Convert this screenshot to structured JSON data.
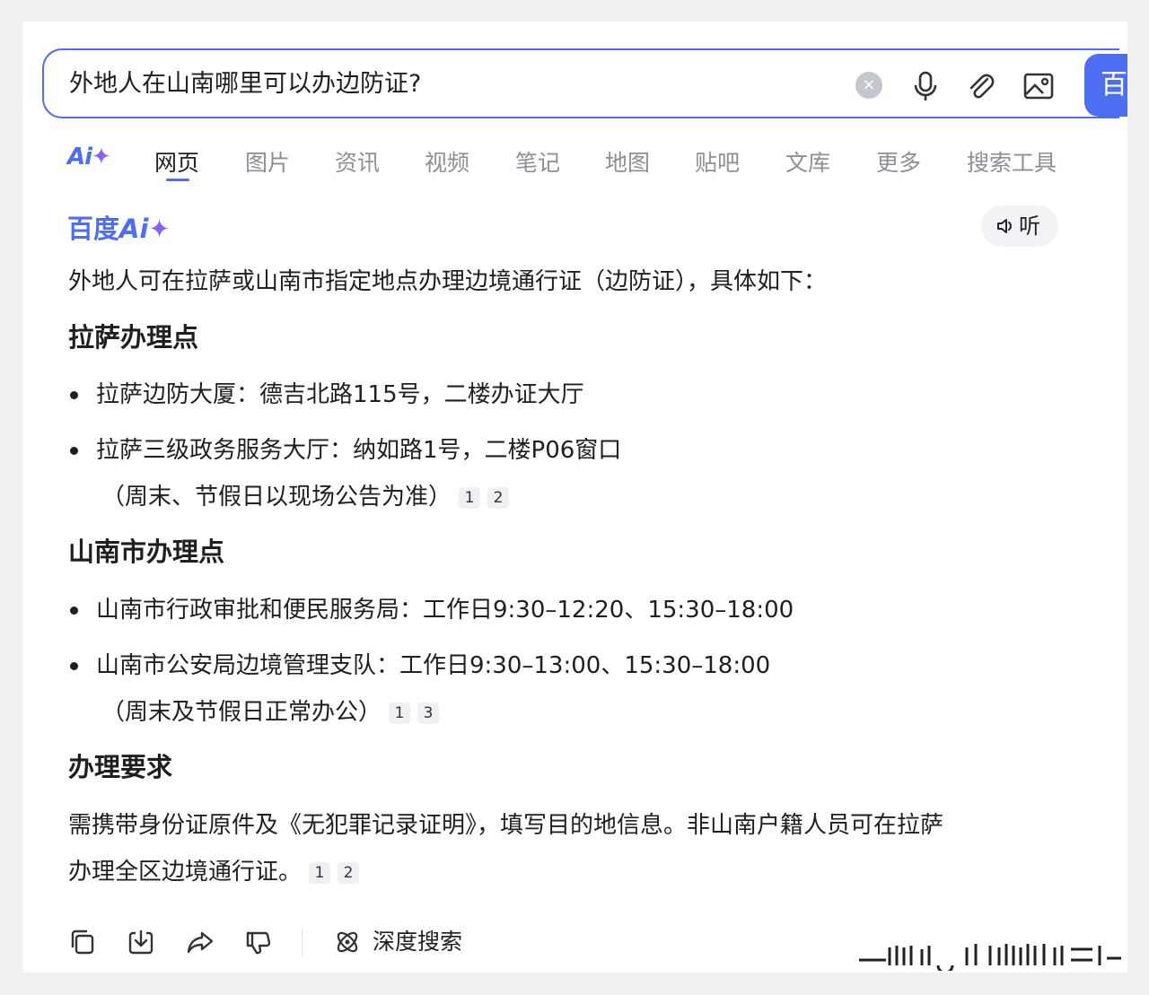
{
  "search": {
    "query": "外地人在山南哪里可以办边防证?",
    "clear_glyph": "×",
    "submit_label": "百度一下"
  },
  "tabs": {
    "ai": "Ai",
    "ai_star": "✦",
    "items": [
      "网页",
      "图片",
      "资讯",
      "视频",
      "笔记",
      "地图",
      "贴吧",
      "文库",
      "更多",
      "搜索工具"
    ],
    "active_index": 0
  },
  "ai_panel": {
    "brand_cn": "百度",
    "brand_ai": "Ai",
    "brand_star": "✦",
    "listen_label": "听",
    "intro": "外地人可在拉萨或山南市指定地点办理边境通行证（边防证），具体如下：",
    "sections": [
      {
        "heading": "拉萨办理点",
        "items": [
          {
            "line1": "拉萨边防大厦：德吉北路115号，二楼办证大厅"
          },
          {
            "line1": "拉萨三级政务服务大厅：纳如路1号，二楼P06窗口",
            "line2": "（周末、节假日以现场公告为准）",
            "cites": [
              "1",
              "2"
            ]
          }
        ]
      },
      {
        "heading": "山南市办理点",
        "items": [
          {
            "line1": "山南市行政审批和便民服务局：工作日9:30–12:20、15:30–18:00"
          },
          {
            "line1": "山南市公安局边境管理支队：工作日9:30–13:00、15:30–18:00",
            "line2": "（周末及节假日正常办公）",
            "cites": [
              "1",
              "3"
            ]
          }
        ]
      },
      {
        "heading": "办理要求",
        "para_line1": "需携带身份证原件及《无犯罪记录证明》，填写目的地信息。非山南户籍人员可在拉萨",
        "para_line2": "办理全区边境通行证。",
        "cites": [
          "1",
          "2"
        ]
      }
    ]
  },
  "actions": {
    "icons": [
      "copy-icon",
      "download-icon",
      "share-icon",
      "dislike-icon"
    ],
    "deep_search_label": "深度搜索"
  },
  "colors": {
    "accent": "#4e6ef2",
    "ai_star": "#8b62f5",
    "muted_tab": "#8c8f96"
  }
}
